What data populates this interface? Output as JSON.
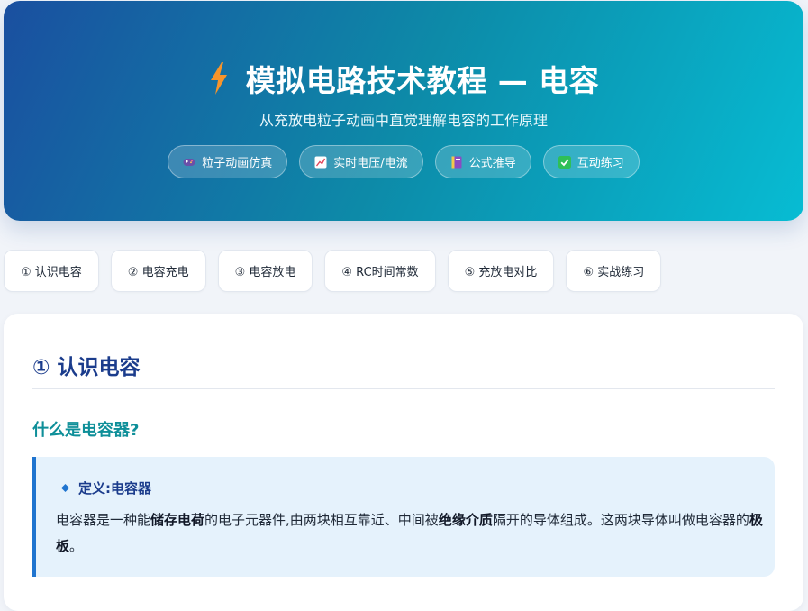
{
  "hero": {
    "title": "模拟电路技术教程 — 电容",
    "subtitle": "从充放电粒子动画中直觉理解电容的工作原理",
    "icon": "lightning-bolt-icon",
    "badges": [
      {
        "label": "粒子动画仿真",
        "icon": "gamepad-icon"
      },
      {
        "label": "实时电压/电流",
        "icon": "chart-up-icon"
      },
      {
        "label": "公式推导",
        "icon": "book-icon"
      },
      {
        "label": "互动练习",
        "icon": "check-icon"
      }
    ]
  },
  "tabs": [
    {
      "label": "① 认识电容"
    },
    {
      "label": "② 电容充电"
    },
    {
      "label": "③ 电容放电"
    },
    {
      "label": "④ RC时间常数"
    },
    {
      "label": "⑤ 充放电对比"
    },
    {
      "label": "⑥ 实战练习"
    }
  ],
  "section": {
    "title": "① 认识电容",
    "subtitle": "什么是电容器?",
    "definition": {
      "head": "定义:电容器",
      "body": {
        "p1": "电容器是一种能",
        "b1": "储存电荷",
        "p2": "的电子元器件,由两块相互靠近、中间被",
        "b2": "绝缘介质",
        "p3": "隔开的导体组成。这两块导体叫做电容器的",
        "b3": "极板",
        "p4": "。"
      }
    }
  },
  "colors": {
    "hero_start": "#1a4fa0",
    "hero_end": "#07bcd3",
    "bolt": "#f7942b",
    "heading": "#1b3c8c",
    "teal": "#0e8f99",
    "def_bg": "#e5f2fc",
    "def_border": "#1f74cf"
  }
}
